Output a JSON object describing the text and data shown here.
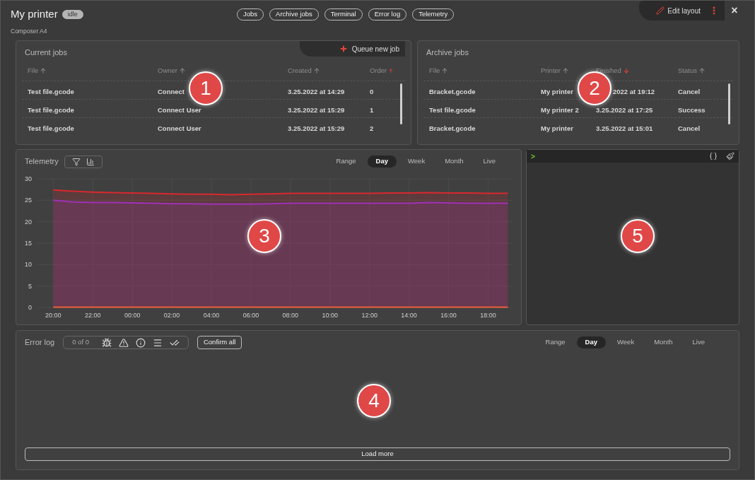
{
  "header": {
    "title": "My printer",
    "status": "idle",
    "subtitle": "Composer A4",
    "nav": [
      "Jobs",
      "Archive jobs",
      "Terminal",
      "Error log",
      "Telemetry"
    ],
    "edit_layout": "Edit layout",
    "close": "×"
  },
  "current_jobs": {
    "title": "Current jobs",
    "action": "Queue new job",
    "columns": [
      {
        "label": "File",
        "sorted": false,
        "descending": false
      },
      {
        "label": "Owner",
        "sorted": false,
        "descending": false
      },
      {
        "label": "Created",
        "sorted": false,
        "descending": false
      },
      {
        "label": "Order",
        "sorted": true,
        "descending": false
      }
    ],
    "rows": [
      [
        "Test file.gcode",
        "Connect",
        "3.25.2022 at 14:29",
        "0"
      ],
      [
        "Test file.gcode",
        "Connect User",
        "3.25.2022 at 15:29",
        "1"
      ],
      [
        "Test file.gcode",
        "Connect User",
        "3.25.2022 at 15:29",
        "2"
      ]
    ]
  },
  "archive_jobs": {
    "title": "Archive jobs",
    "columns": [
      {
        "label": "File",
        "sorted": false,
        "descending": false
      },
      {
        "label": "Printer",
        "sorted": false,
        "descending": false
      },
      {
        "label": "Finished",
        "sorted": true,
        "descending": true
      },
      {
        "label": "Status",
        "sorted": false,
        "descending": false
      }
    ],
    "rows": [
      [
        "Bracket.gcode",
        "My printer",
        "2022 at 19:12",
        "Cancel"
      ],
      [
        "Test file.gcode",
        "My printer 2",
        "3.25.2022 at 17:25",
        "Success"
      ],
      [
        "Bracket.gcode",
        "My printer",
        "3.25.2022 at 15:01",
        "Cancel"
      ]
    ]
  },
  "telemetry": {
    "title": "Telemetry",
    "ranges": [
      {
        "label": "Range",
        "selected": false
      },
      {
        "label": "Day",
        "selected": true
      },
      {
        "label": "Week",
        "selected": false
      },
      {
        "label": "Month",
        "selected": false
      },
      {
        "label": "Live",
        "selected": false
      }
    ],
    "chart_data": {
      "type": "area",
      "grid": true,
      "categories": [
        "20:00",
        null,
        "22:00",
        null,
        "00:00",
        null,
        "02:00",
        null,
        "04:00",
        null,
        "06:00",
        null,
        "08:00",
        null,
        "10:00",
        null,
        "12:00",
        null,
        "14:00",
        null,
        "16:00",
        null,
        "18:00",
        null
      ],
      "ylim": [
        0,
        30
      ],
      "yticks": [
        0,
        5,
        10,
        15,
        20,
        25,
        30
      ],
      "series": [
        {
          "color": "#d8282e",
          "values": [
            27.4,
            27.1,
            26.9,
            26.8,
            26.7,
            26.6,
            26.5,
            26.4,
            26.4,
            26.3,
            26.4,
            26.5,
            26.6,
            26.6,
            26.6,
            26.6,
            26.6,
            26.7,
            26.7,
            26.8,
            26.7,
            26.7,
            26.6,
            26.6
          ]
        },
        {
          "color": "#a030b8",
          "values": [
            25.0,
            24.6,
            24.5,
            24.5,
            24.4,
            24.3,
            24.2,
            24.2,
            24.1,
            24.1,
            24.1,
            24.2,
            24.3,
            24.3,
            24.3,
            24.3,
            24.3,
            24.3,
            24.3,
            24.5,
            24.4,
            24.3,
            24.3,
            24.3
          ]
        },
        {
          "color": "#e8603a",
          "values": [
            0.1,
            0.1,
            0.1,
            0.1,
            0.1,
            0.1,
            0.1,
            0.1,
            0.1,
            0.1,
            0.1,
            0.1,
            0.1,
            0.1,
            0.1,
            0.1,
            0.1,
            0.1,
            0.1,
            0.1,
            0.1,
            0.1,
            0.1,
            0.1
          ]
        }
      ]
    }
  },
  "terminal": {
    "prompt": ">"
  },
  "error_log": {
    "title": "Error log",
    "count": "0 of 0",
    "confirm": "Confirm all",
    "ranges": [
      {
        "label": "Range",
        "selected": false
      },
      {
        "label": "Day",
        "selected": true
      },
      {
        "label": "Week",
        "selected": false
      },
      {
        "label": "Month",
        "selected": false
      },
      {
        "label": "Live",
        "selected": false
      }
    ],
    "load_more": "Load more"
  },
  "callouts": [
    "1",
    "2",
    "3",
    "4",
    "5"
  ]
}
